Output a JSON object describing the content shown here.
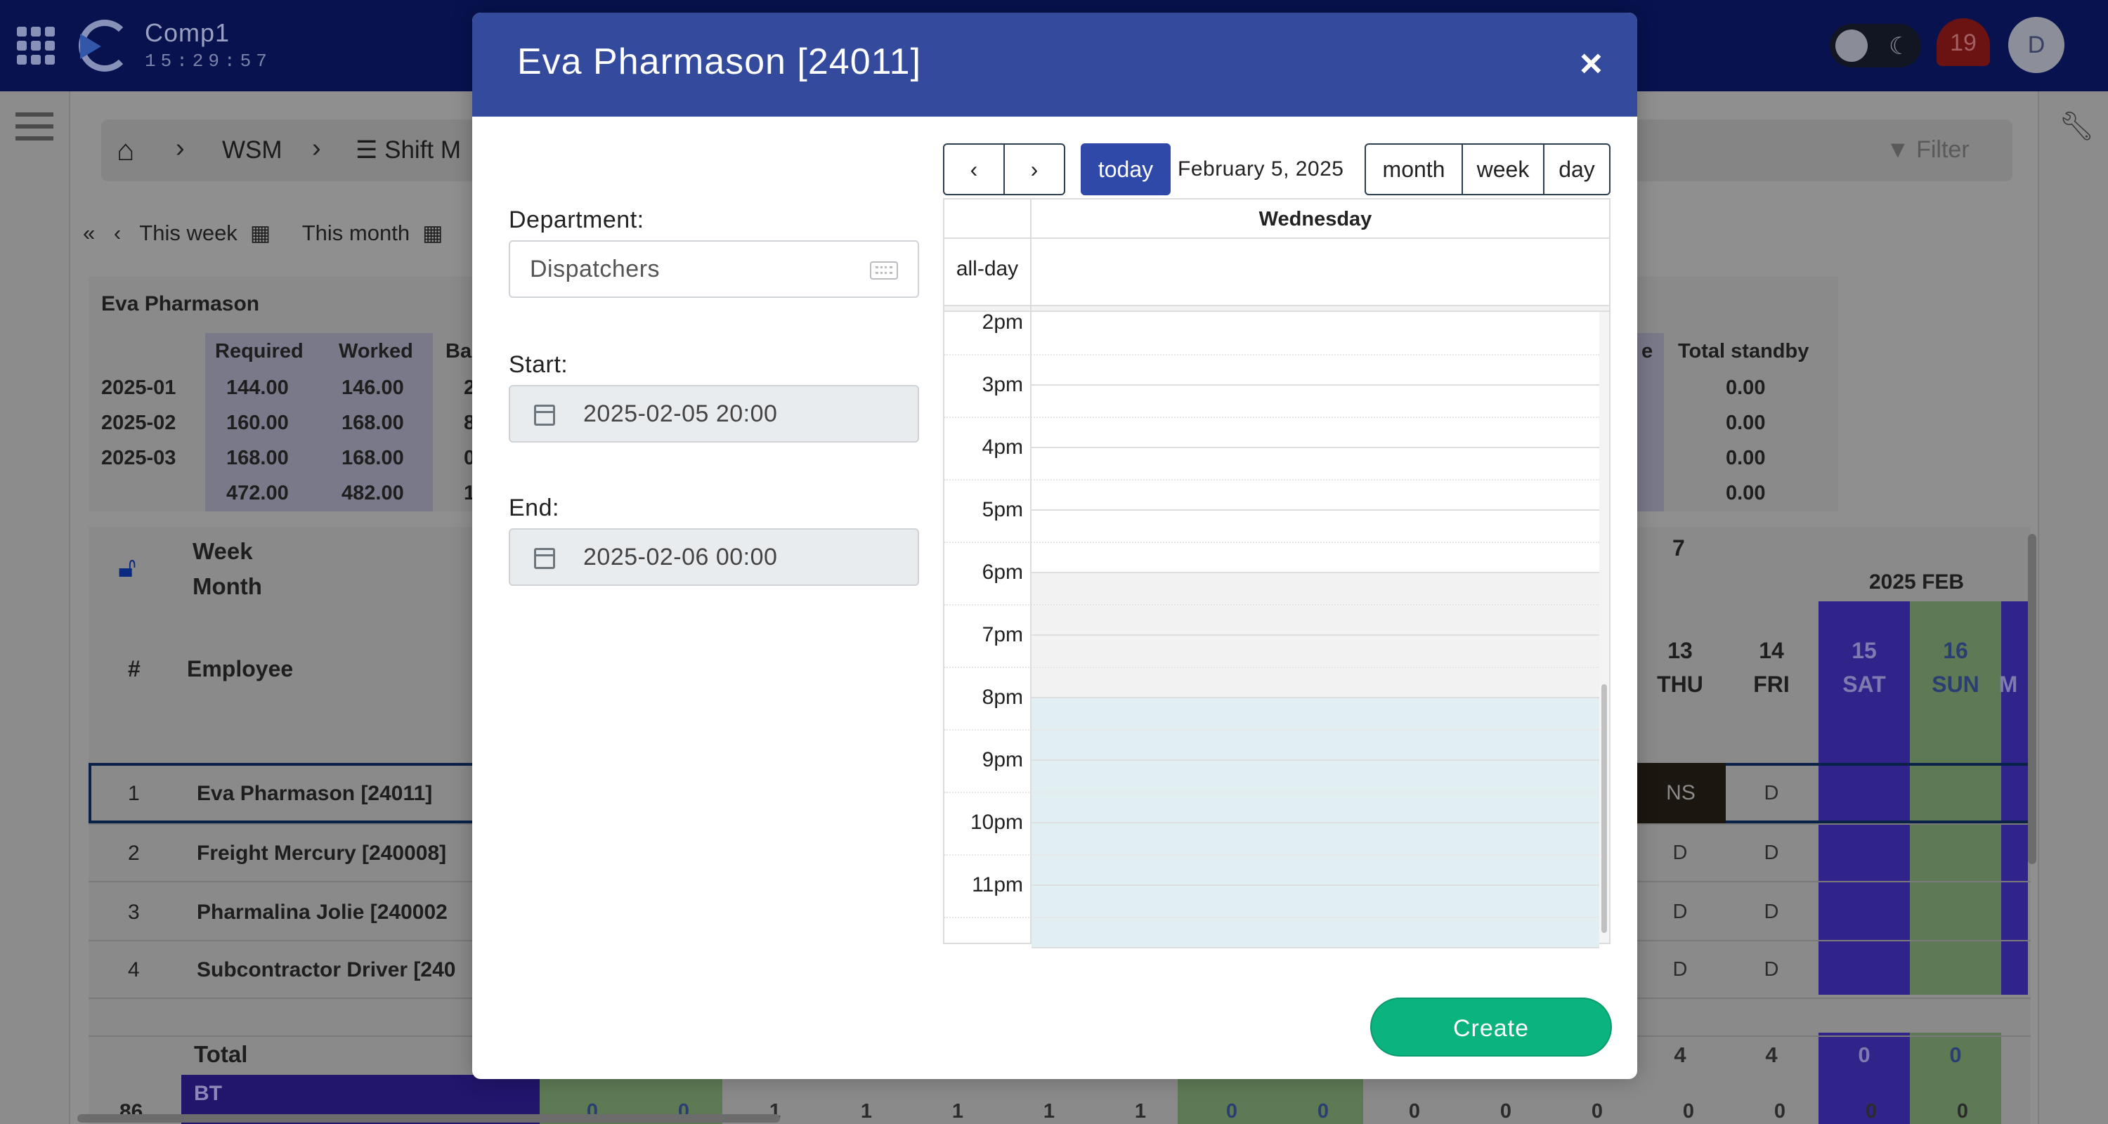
{
  "topbar": {
    "company": "Comp1",
    "clock": "15:29:57",
    "notification_count": "19",
    "avatar_initial": "D"
  },
  "breadcrumb": {
    "sep": "›",
    "items": [
      "WSM",
      "Shift M"
    ],
    "filter_label": "Filter"
  },
  "period_nav": {
    "first": "«",
    "prev": "‹",
    "this_week": "This week",
    "this_month": "This month"
  },
  "summary": {
    "employee": "Eva Pharmason",
    "headers": [
      "Required",
      "Worked",
      "Ba"
    ],
    "right_headers": [
      "e",
      "Total standby"
    ],
    "rows": [
      {
        "period": "2025-01",
        "required": "144.00",
        "worked": "146.00",
        "balance": "2",
        "standby": "0.00"
      },
      {
        "period": "2025-02",
        "required": "160.00",
        "worked": "168.00",
        "balance": "8",
        "standby": "0.00"
      },
      {
        "period": "2025-03",
        "required": "168.00",
        "worked": "168.00",
        "balance": "0",
        "standby": "0.00"
      },
      {
        "period": "",
        "required": "472.00",
        "worked": "482.00",
        "balance": "1",
        "standby": "0.00"
      }
    ]
  },
  "grid": {
    "week_label": "Week",
    "month_label": "Month",
    "hash": "#",
    "employee_header": "Employee",
    "week_number": "7",
    "month_header": "2025 FEB",
    "days": [
      {
        "num": "13",
        "dow": "THU"
      },
      {
        "num": "14",
        "dow": "FRI"
      },
      {
        "num": "15",
        "dow": "SAT"
      },
      {
        "num": "16",
        "dow": "SUN"
      },
      {
        "num": "",
        "dow": "M"
      }
    ],
    "employees": [
      {
        "num": "1",
        "name": "Eva Pharmason [24011]",
        "thu": "NS",
        "fri": "D"
      },
      {
        "num": "2",
        "name": "Freight Mercury [240008]",
        "thu": "D",
        "fri": "D"
      },
      {
        "num": "3",
        "name": "Pharmalina Jolie [240002",
        "thu": "D",
        "fri": "D"
      },
      {
        "num": "4",
        "name": "Subcontractor Driver [240",
        "thu": "D",
        "fri": "D"
      }
    ],
    "total_label": "Total",
    "totals": [
      "4",
      "4",
      "0",
      "0"
    ],
    "bt_label": "BT",
    "bt_number": "86",
    "bt_values": [
      "0",
      "0",
      "1",
      "1",
      "1",
      "1",
      "1",
      "0",
      "0",
      "0",
      "0",
      "0",
      "0",
      "0",
      "0",
      "0"
    ]
  },
  "modal": {
    "title": "Eva Pharmason [24011]",
    "close": "×",
    "department_label": "Department:",
    "department_value": "Dispatchers",
    "start_label": "Start:",
    "start_value": "2025-02-05 20:00",
    "end_label": "End:",
    "end_value": "2025-02-06 00:00",
    "create_label": "Create"
  },
  "calendar": {
    "prev": "‹",
    "next": "›",
    "today": "today",
    "date_title": "February 5, 2025",
    "views": [
      "month",
      "week",
      "day"
    ],
    "day_header": "Wednesday",
    "all_day": "all-day",
    "hours": [
      "2pm",
      "3pm",
      "4pm",
      "5pm",
      "6pm",
      "7pm",
      "8pm",
      "9pm",
      "10pm",
      "11pm"
    ],
    "colors": {
      "selection": "#e1eff3",
      "past": "#f2f2f2",
      "accent": "#2e49a8",
      "create": "#0bb37e"
    }
  }
}
